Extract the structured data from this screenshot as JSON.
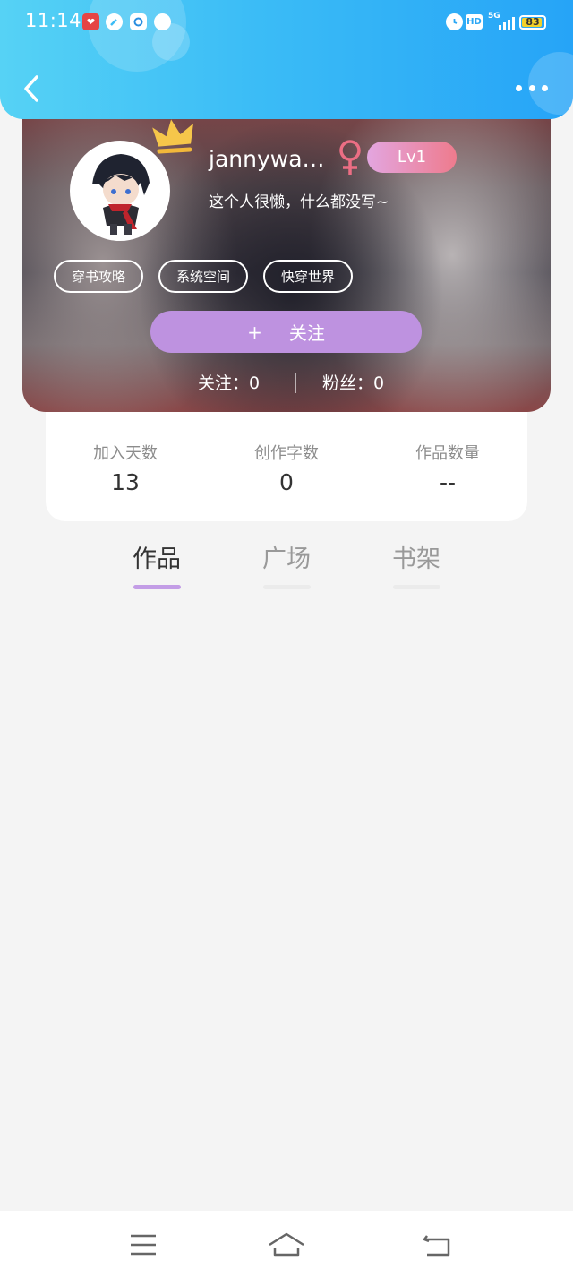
{
  "status_bar": {
    "time": "11:14",
    "battery": "83",
    "network": "5G",
    "hd_label": "HD"
  },
  "header": {
    "back_icon": "chevron-left-icon",
    "more_icon": "more-dots-icon"
  },
  "profile": {
    "username": "jannywa…",
    "gender_icon": "female-icon",
    "level": "Lv1",
    "bio": "这个人很懒，什么都没写~",
    "tags": [
      "穿书攻略",
      "系统空间",
      "快穿世界"
    ],
    "follow_plus": "+",
    "follow_label": "关注",
    "following_label": "关注：",
    "following_count": "0",
    "fans_label": "粉丝：",
    "fans_count": "0"
  },
  "stats": [
    {
      "label": "加入天数",
      "value": "13"
    },
    {
      "label": "创作字数",
      "value": "0"
    },
    {
      "label": "作品数量",
      "value": "--"
    }
  ],
  "tabs": [
    {
      "label": "作品",
      "active": true
    },
    {
      "label": "广场",
      "active": false
    },
    {
      "label": "书架",
      "active": false
    }
  ],
  "colors": {
    "header_blue": "#3bbcf6",
    "accent_purple": "#be92e0",
    "level_pink": "#ee7b8d"
  }
}
